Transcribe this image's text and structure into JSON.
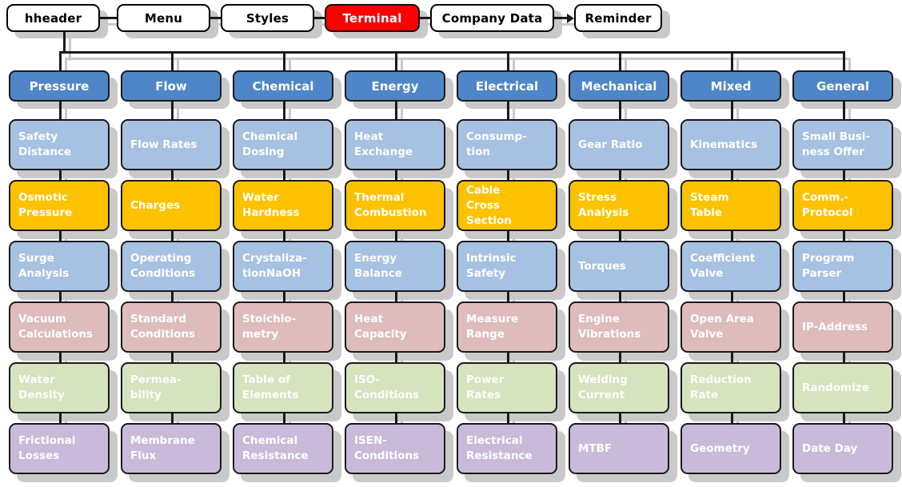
{
  "nav": {
    "items": [
      {
        "label": "hheader",
        "accent": false
      },
      {
        "label": "Menu",
        "accent": false
      },
      {
        "label": "Styles",
        "accent": false
      },
      {
        "label": "Terminal",
        "accent": true
      },
      {
        "label": "Company Data",
        "accent": false
      },
      {
        "label": "Reminder",
        "accent": false
      }
    ],
    "accent_color": "#fa0000",
    "arrow_before": "Reminder"
  },
  "palette": {
    "header_blue": "#4e86c8",
    "row_blue": "#a7c1e3",
    "row_gold": "#fcc200",
    "row_pink": "#debcbc",
    "row_green": "#d5e3bf",
    "row_purple": "#c9bada",
    "shadow": "#c9c9c9",
    "outline": "#1a1a1a"
  },
  "columns": [
    {
      "header": "Pressure",
      "items": [
        {
          "label": "Safety\nDistance",
          "color": "row_blue"
        },
        {
          "label": "Osmotic\nPressure",
          "color": "row_gold"
        },
        {
          "label": "Surge\nAnalysis",
          "color": "row_blue"
        },
        {
          "label": "Vacuum\nCalculations",
          "color": "row_pink"
        },
        {
          "label": "Water\nDensity",
          "color": "row_green"
        },
        {
          "label": "Frictional\nLosses",
          "color": "row_purple"
        }
      ]
    },
    {
      "header": "Flow",
      "items": [
        {
          "label": "Flow Rates",
          "color": "row_blue"
        },
        {
          "label": "Charges",
          "color": "row_gold"
        },
        {
          "label": "Operating\nConditions",
          "color": "row_blue"
        },
        {
          "label": "Standard\nConditions",
          "color": "row_pink"
        },
        {
          "label": "Permea-\nbility",
          "color": "row_green"
        },
        {
          "label": "Membrane\nFlux",
          "color": "row_purple"
        }
      ]
    },
    {
      "header": "Chemical",
      "items": [
        {
          "label": "Chemical\nDosing",
          "color": "row_blue"
        },
        {
          "label": "Water\nHardness",
          "color": "row_gold"
        },
        {
          "label": "Crystaliza-\ntionNaOH",
          "color": "row_blue"
        },
        {
          "label": "Stoichio-\nmetry",
          "color": "row_pink"
        },
        {
          "label": "Table of\nElements",
          "color": "row_green"
        },
        {
          "label": "Chemical\nResistance",
          "color": "row_purple"
        }
      ]
    },
    {
      "header": "Energy",
      "items": [
        {
          "label": "Heat\nExchange",
          "color": "row_blue"
        },
        {
          "label": "Thermal\nCombustion",
          "color": "row_gold"
        },
        {
          "label": "Energy\nBalance",
          "color": "row_blue"
        },
        {
          "label": "Heat\nCapacity",
          "color": "row_pink"
        },
        {
          "label": "ISO-\nConditions",
          "color": "row_green"
        },
        {
          "label": "ISEN-\nConditions",
          "color": "row_purple"
        }
      ]
    },
    {
      "header": "Electrical",
      "items": [
        {
          "label": "Consump-\ntion",
          "color": "row_blue"
        },
        {
          "label": "Cable\nCross Section",
          "color": "row_gold"
        },
        {
          "label": "Intrinsic\nSafety",
          "color": "row_blue"
        },
        {
          "label": "Measure\nRange",
          "color": "row_pink"
        },
        {
          "label": "Power\nRates",
          "color": "row_green"
        },
        {
          "label": "Electrical\nResistance",
          "color": "row_purple"
        }
      ]
    },
    {
      "header": "Mechanical",
      "items": [
        {
          "label": "Gear Ratio",
          "color": "row_blue"
        },
        {
          "label": "Stress\nAnalysis",
          "color": "row_gold"
        },
        {
          "label": "Torques",
          "color": "row_blue"
        },
        {
          "label": "Engine\nVibrations",
          "color": "row_pink"
        },
        {
          "label": "Welding\nCurrent",
          "color": "row_green"
        },
        {
          "label": "MTBF",
          "color": "row_purple"
        }
      ]
    },
    {
      "header": "Mixed",
      "items": [
        {
          "label": "Kinematics",
          "color": "row_blue"
        },
        {
          "label": "Steam\nTable",
          "color": "row_gold"
        },
        {
          "label": "Coefficient\nValve",
          "color": "row_blue"
        },
        {
          "label": "Open Area\nValve",
          "color": "row_pink"
        },
        {
          "label": "Reduction\nRate",
          "color": "row_green"
        },
        {
          "label": "Geometry",
          "color": "row_purple"
        }
      ]
    },
    {
      "header": "General",
      "items": [
        {
          "label": "Small Busi-\nness Offer",
          "color": "row_blue"
        },
        {
          "label": "Comm.-\nProtocol",
          "color": "row_gold"
        },
        {
          "label": "Program\nParser",
          "color": "row_blue"
        },
        {
          "label": "IP-Address",
          "color": "row_pink"
        },
        {
          "label": "Randomize",
          "color": "row_green"
        },
        {
          "label": "Date Day",
          "color": "row_purple"
        }
      ]
    }
  ]
}
